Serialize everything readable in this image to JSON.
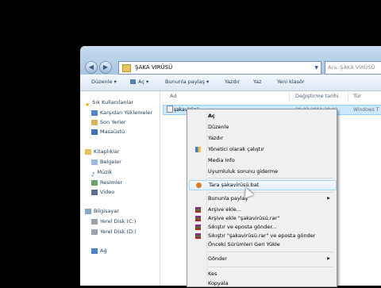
{
  "window": {
    "address_path": "ŞAKA VIRÜSÜ",
    "search_placeholder": "Ara: ŞAKA VİRÜSÜ"
  },
  "toolbar": {
    "organize": "Düzenle",
    "open": "Aç",
    "share": "Bununla paylaş",
    "print": "Yazdır",
    "write": "Yaz",
    "new_folder": "Yeni klasör"
  },
  "sidebar": {
    "favorites": {
      "title": "Sık Kullanılanlar",
      "items": [
        {
          "label": "Karşıdan Yüklemeler"
        },
        {
          "label": "Son Yerler"
        },
        {
          "label": "Masaüstü"
        }
      ]
    },
    "libraries": {
      "title": "Kitaplıklar",
      "items": [
        {
          "label": "Belgeler"
        },
        {
          "label": "Müzik"
        },
        {
          "label": "Resimler"
        },
        {
          "label": "Video"
        }
      ]
    },
    "computer": {
      "title": "Bilgisayar",
      "items": [
        {
          "label": "Yerel Disk (C:)"
        },
        {
          "label": "Yerel Disk (D:)"
        }
      ]
    },
    "network": {
      "title": "Ağ"
    }
  },
  "columns": {
    "name": "Ad",
    "date": "Değiştirme tarihi",
    "type": "Tür"
  },
  "file": {
    "name": "şakavirüsü",
    "date": "28.03.2011 20:02",
    "type": "Windows T"
  },
  "context_menu": {
    "items": [
      {
        "label": "Aç"
      },
      {
        "label": "Düzenle"
      },
      {
        "label": "Yazdır"
      },
      {
        "label": "Yönetici olarak çalıştır"
      },
      {
        "label": "Media Info"
      },
      {
        "label": "Uyumluluk sorunu giderme"
      },
      {
        "label": "Tara şakavirüsü.bat"
      },
      {
        "label": "Bununla paylaş"
      },
      {
        "label": "Arşive ekle..."
      },
      {
        "label": "Arşive ekle \"şakavirüsü.rar\""
      },
      {
        "label": "Sıkıştır ve eposta gönder..."
      },
      {
        "label": "Sıkıştır \"şakavirüsü.rar\" ve eposta gönder"
      },
      {
        "label": "Önceki Sürümleri Geri Yükle"
      },
      {
        "label": "Gönder"
      },
      {
        "label": "Kes"
      },
      {
        "label": "Kopyala"
      }
    ]
  }
}
